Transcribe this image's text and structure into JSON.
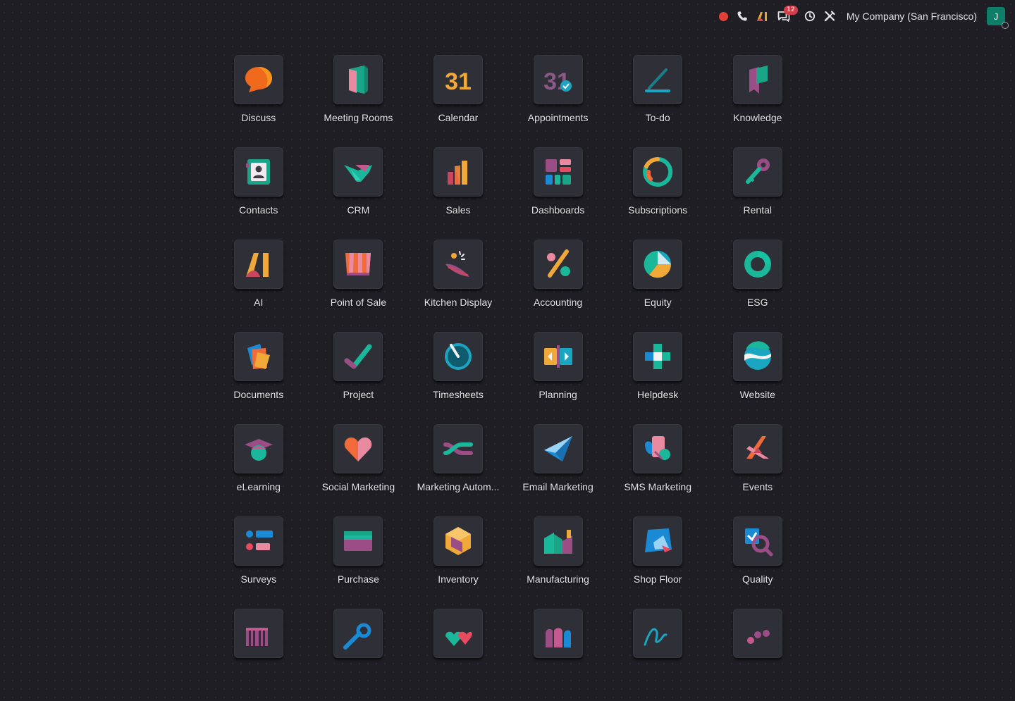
{
  "topbar": {
    "recording_color": "#e0403a",
    "icons": [
      "phone-icon",
      "ai-icon",
      "messages-icon",
      "clock-icon",
      "tools-icon"
    ],
    "messages_badge": "12",
    "company": "My Company (San Francisco)",
    "avatar_initial": "J",
    "avatar_color": "#0f7e68"
  },
  "apps": [
    {
      "label": "Discuss",
      "icon": "discuss-icon"
    },
    {
      "label": "Meeting Rooms",
      "icon": "meeting-rooms-icon"
    },
    {
      "label": "Calendar",
      "icon": "calendar-icon",
      "icon_text": "31"
    },
    {
      "label": "Appointments",
      "icon": "appointments-icon",
      "icon_text": "31"
    },
    {
      "label": "To-do",
      "icon": "todo-icon"
    },
    {
      "label": "Knowledge",
      "icon": "knowledge-icon"
    },
    {
      "label": "Contacts",
      "icon": "contacts-icon"
    },
    {
      "label": "CRM",
      "icon": "crm-icon"
    },
    {
      "label": "Sales",
      "icon": "sales-icon"
    },
    {
      "label": "Dashboards",
      "icon": "dashboards-icon"
    },
    {
      "label": "Subscriptions",
      "icon": "subscriptions-icon"
    },
    {
      "label": "Rental",
      "icon": "rental-icon"
    },
    {
      "label": "AI",
      "icon": "ai-app-icon"
    },
    {
      "label": "Point of Sale",
      "icon": "point-of-sale-icon"
    },
    {
      "label": "Kitchen Display",
      "icon": "kitchen-display-icon"
    },
    {
      "label": "Accounting",
      "icon": "accounting-icon"
    },
    {
      "label": "Equity",
      "icon": "equity-icon"
    },
    {
      "label": "ESG",
      "icon": "esg-icon"
    },
    {
      "label": "Documents",
      "icon": "documents-icon"
    },
    {
      "label": "Project",
      "icon": "project-icon"
    },
    {
      "label": "Timesheets",
      "icon": "timesheets-icon"
    },
    {
      "label": "Planning",
      "icon": "planning-icon"
    },
    {
      "label": "Helpdesk",
      "icon": "helpdesk-icon"
    },
    {
      "label": "Website",
      "icon": "website-icon"
    },
    {
      "label": "eLearning",
      "icon": "elearning-icon"
    },
    {
      "label": "Social Marketing",
      "icon": "social-marketing-icon"
    },
    {
      "label": "Marketing Autom...",
      "icon": "marketing-automation-icon"
    },
    {
      "label": "Email Marketing",
      "icon": "email-marketing-icon"
    },
    {
      "label": "SMS Marketing",
      "icon": "sms-marketing-icon"
    },
    {
      "label": "Events",
      "icon": "events-icon"
    },
    {
      "label": "Surveys",
      "icon": "surveys-icon"
    },
    {
      "label": "Purchase",
      "icon": "purchase-icon"
    },
    {
      "label": "Inventory",
      "icon": "inventory-icon"
    },
    {
      "label": "Manufacturing",
      "icon": "manufacturing-icon"
    },
    {
      "label": "Shop Floor",
      "icon": "shop-floor-icon"
    },
    {
      "label": "Quality",
      "icon": "quality-icon"
    },
    {
      "label": "",
      "icon": "barcode-icon"
    },
    {
      "label": "",
      "icon": "maintenance-icon"
    },
    {
      "label": "",
      "icon": "employees-icon"
    },
    {
      "label": "",
      "icon": "attendances-icon"
    },
    {
      "label": "",
      "icon": "signature-icon"
    },
    {
      "label": "",
      "icon": "recruitment-icon"
    }
  ]
}
